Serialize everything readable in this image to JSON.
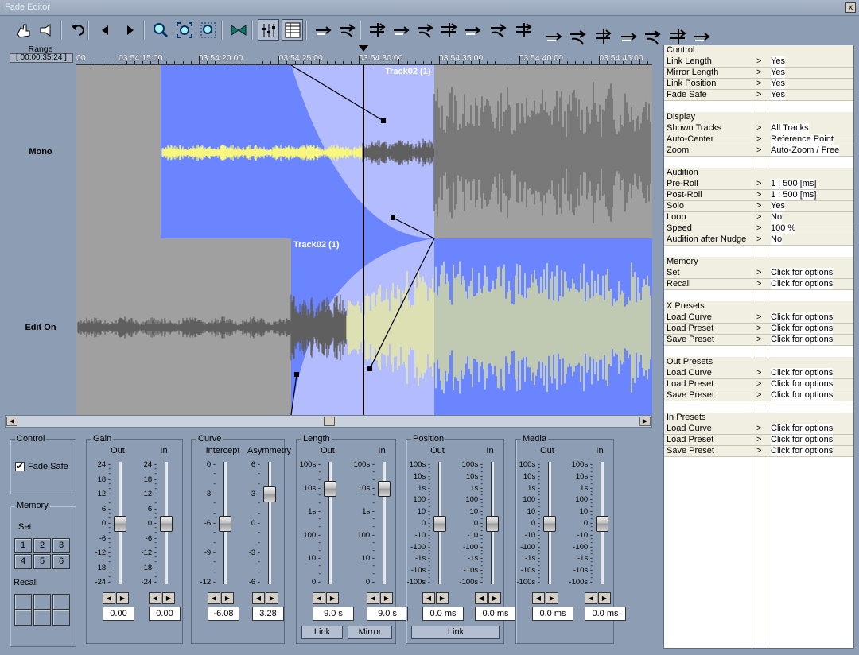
{
  "window": {
    "title": "Fade Editor",
    "close_glyph": "x"
  },
  "toolbar": {
    "icons": [
      "hand-pointer-icon",
      "hand-speaker-icon",
      "undo-icon",
      "prev-icon",
      "next-icon",
      "zoom-icon",
      "zoom-fit-icon",
      "zoom-selection-icon",
      "crossfade-icon",
      "sliders-view-icon",
      "table-view-icon",
      "fade-shape-1-icon",
      "fade-shape-2-icon",
      "align-1-icon",
      "align-2-icon",
      "align-3-icon",
      "align-4-icon",
      "align-5-icon",
      "align-6-icon",
      "align-7-icon",
      "nudge-1-icon",
      "nudge-2-icon",
      "nudge-3-icon",
      "nudge-4-icon",
      "nudge-5-icon",
      "nudge-6-icon",
      "nudge-7-icon"
    ]
  },
  "ruler": {
    "range_label": "Range",
    "range_value": "[ 00:00:35:24 ]",
    "start_fragment": "00",
    "labels": [
      "03:54:15:00",
      "03:54:20:00",
      "03:54:25:00",
      "03:54:30:00",
      "03:54:35:00",
      "03:54:40:00",
      "03:54:45:00"
    ]
  },
  "tracks": [
    {
      "name": "Mono",
      "clip_label": "Track02 (1)"
    },
    {
      "name": "Edit On",
      "clip_label": "Track02 (1)"
    }
  ],
  "colors": {
    "clip_blue": "#6b84ff",
    "fade_light": "#b3bcff",
    "wave_yellow": "#f7f780",
    "wave_grey": "#5f5f5f",
    "bg_grey": "#a0a0a0"
  },
  "control_group": {
    "title": "Control",
    "fade_safe_label": "Fade Safe",
    "fade_safe_checked": true,
    "check_glyph": "✔"
  },
  "memory_group": {
    "title": "Memory",
    "set_label": "Set",
    "buttons": [
      "1",
      "2",
      "3",
      "4",
      "5",
      "6"
    ],
    "recall_label": "Recall"
  },
  "gain": {
    "title": "Gain",
    "out_label": "Out",
    "in_label": "In",
    "scale": [
      "24",
      "18",
      "12",
      "6",
      "0",
      "-6",
      "-12",
      "-18",
      "-24"
    ],
    "out_value": "0.00",
    "in_value": "0.00"
  },
  "curve": {
    "title": "Curve",
    "intercept_label": "Intercept",
    "asym_label": "Asymmetry",
    "intercept_scale": [
      "0",
      "-3",
      "-6",
      "-9",
      "-12"
    ],
    "asym_scale": [
      "6",
      "3",
      "0",
      "-3",
      "-6"
    ],
    "intercept_value": "-6.08",
    "asym_value": "3.28"
  },
  "length": {
    "title": "Length",
    "out_label": "Out",
    "in_label": "In",
    "scale": [
      "100s",
      "10s",
      "1s",
      "100",
      "10",
      "0"
    ],
    "out_value": "9.0 s",
    "in_value": "9.0 s",
    "link_label": "Link",
    "mirror_label": "Mirror"
  },
  "position": {
    "title": "Position",
    "out_label": "Out",
    "in_label": "In",
    "scale": [
      "100s",
      "10s",
      "1s",
      "100",
      "10",
      "0",
      "-10",
      "-100",
      "-1s",
      "-10s",
      "-100s"
    ],
    "out_value": "0.0 ms",
    "in_value": "0.0 ms",
    "link_label": "Link"
  },
  "media": {
    "title": "Media",
    "out_label": "Out",
    "in_label": "In",
    "scale": [
      "100s",
      "10s",
      "1s",
      "100",
      "10",
      "0",
      "-10",
      "-100",
      "-1s",
      "-10s",
      "-100s"
    ],
    "out_value": "0.0 ms",
    "in_value": "0.0 ms"
  },
  "arrows": {
    "left": "◀",
    "right": "▶"
  },
  "panel": {
    "sections": [
      {
        "title": "Control",
        "rows": [
          {
            "name": "Link Length",
            "value": "Yes"
          },
          {
            "name": "Mirror Length",
            "value": "Yes"
          },
          {
            "name": "Link Position",
            "value": "Yes"
          },
          {
            "name": "Fade Safe",
            "value": "Yes"
          }
        ]
      },
      {
        "title": "Display",
        "rows": [
          {
            "name": "Shown Tracks",
            "value": "All Tracks"
          },
          {
            "name": "Auto-Center",
            "value": "Reference Point"
          },
          {
            "name": "Zoom",
            "value": "Auto-Zoom / Free"
          }
        ]
      },
      {
        "title": "Audition",
        "rows": [
          {
            "name": "Pre-Roll",
            "value": "1 : 500 [ms]"
          },
          {
            "name": "Post-Roll",
            "value": "1 : 500 [ms]"
          },
          {
            "name": "Solo",
            "value": "Yes"
          },
          {
            "name": "Loop",
            "value": "No"
          },
          {
            "name": "Speed",
            "value": "100 %"
          },
          {
            "name": "Audition after Nudge",
            "value": "No"
          }
        ]
      },
      {
        "title": "Memory",
        "rows": [
          {
            "name": "Set",
            "value": "Click for options"
          },
          {
            "name": "Recall",
            "value": "Click for options"
          }
        ]
      },
      {
        "title": "X Presets",
        "rows": [
          {
            "name": "Load Curve",
            "value": "Click for options"
          },
          {
            "name": "Load Preset",
            "value": "Click for options"
          },
          {
            "name": "Save Preset",
            "value": "Click for options"
          }
        ]
      },
      {
        "title": "Out Presets",
        "rows": [
          {
            "name": "Load Curve",
            "value": "Click for options"
          },
          {
            "name": "Load Preset",
            "value": "Click for options"
          },
          {
            "name": "Save Preset",
            "value": "Click for options"
          }
        ]
      },
      {
        "title": "In Presets",
        "rows": [
          {
            "name": "Load Curve",
            "value": "Click for options"
          },
          {
            "name": "Load Preset",
            "value": "Click for options"
          },
          {
            "name": "Save Preset",
            "value": "Click for options"
          }
        ]
      }
    ],
    "arrow": ">"
  }
}
